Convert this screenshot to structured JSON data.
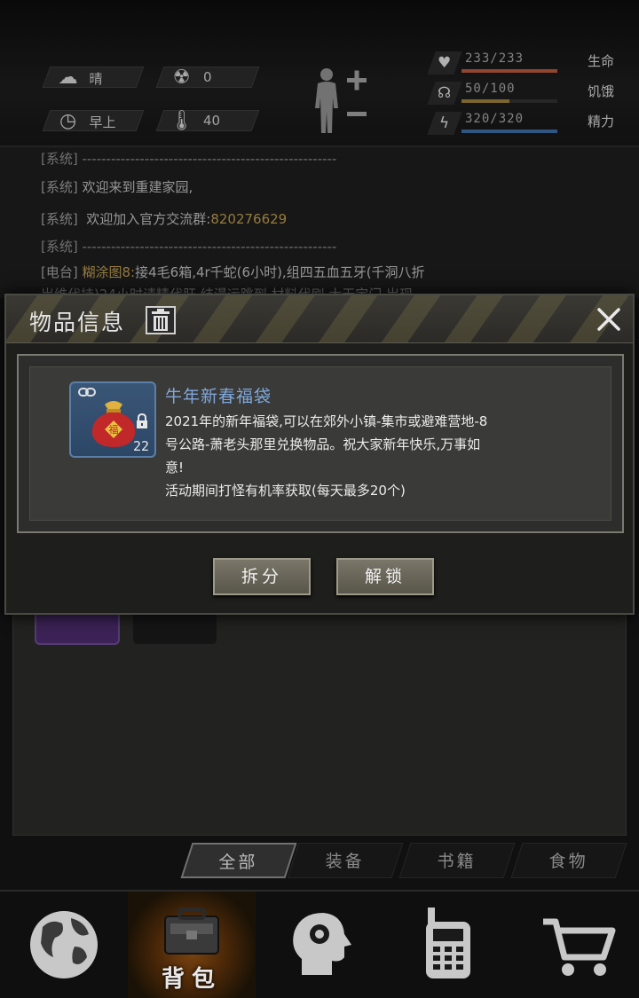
{
  "environment": {
    "weather": "晴",
    "radiation": "0",
    "time_of_day": "早上",
    "temperature": "40"
  },
  "stats": [
    {
      "name": "生命",
      "value": "233/233",
      "fraction": 1.0,
      "color": "#b4553a",
      "icon": "heart-icon"
    },
    {
      "name": "饥饿",
      "value": "50/100",
      "fraction": 0.5,
      "color": "#9a7a3a",
      "icon": "stomach-icon"
    },
    {
      "name": "精力",
      "value": "320/320",
      "fraction": 1.0,
      "color": "#3a6aa0",
      "icon": "energy-icon"
    }
  ],
  "log": {
    "line0": "[系统] -----------------------------------------------------",
    "line1_tag": "[系统]",
    "line1_text": "欢迎来到重建家园,",
    "line2_tag": "[系统]",
    "line2_text": "欢迎加入官方交流群:",
    "line2_number": "820276629",
    "line3": "[系统] -----------------------------------------------------",
    "line4_tag": "[电台]",
    "line4_gold": "糊涂图8:",
    "line4_text": "接4毛6箱,4r千蛇(6小时),组四五血五牙(千洞八折",
    "line5": "   岀维代持)24小时请精代肝,结漫运跳到,材料代刷,大无定门,岀现"
  },
  "modal": {
    "title": "物品信息",
    "item": {
      "name": "牛年新春福袋",
      "count": "22",
      "desc_line1": "2021年的新年福袋,可以在郊外小镇-集市或避难营地-8",
      "desc_line2": "号公路-萧老头那里兑换物品。祝大家新年快乐,万事如",
      "desc_line3": "意!",
      "desc_line4": "活动期间打怪有机率获取(每天最多20个)"
    },
    "split_label": "拆分",
    "unlock_label": "解锁"
  },
  "tabs": {
    "all": "全部",
    "equipment": "装备",
    "books": "书籍",
    "food": "食物"
  },
  "bottom_nav": {
    "backpack_label": "背包"
  },
  "colors": {
    "accent_gold": "#b8974e",
    "item_name_blue": "#7fa7dc",
    "active_nav": "#7a4410"
  }
}
